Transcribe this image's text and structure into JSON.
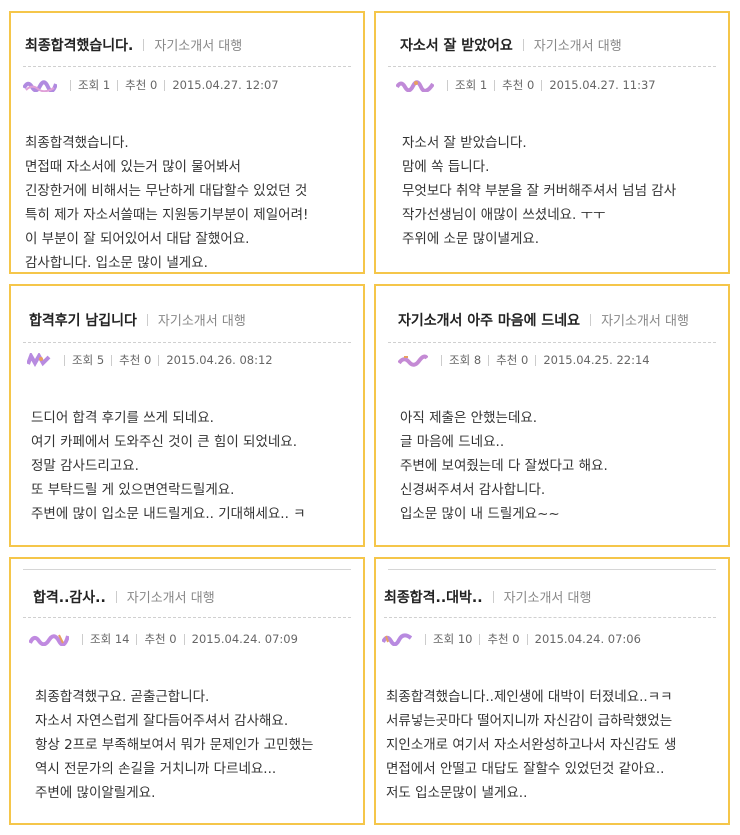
{
  "posts": [
    {
      "title": "최종합격했습니다.",
      "category": "자기소개서 대행",
      "views_label": "조회",
      "views": "1",
      "likes_label": "추천",
      "likes": "0",
      "date": "2015.04.27. 12:07",
      "avatar_color": "#b08ae0",
      "body": [
        "최종합격했습니다.",
        "면접때 자소서에 있는거 많이 물어봐서",
        "긴장한거에 비해서는 무난하게 대답할수 있었던 것",
        "특히 제가 자소서쓸때는 지원동기부분이 제일어려!",
        "이 부분이 잘 되어있어서 대답 잘했어요.",
        "감사합니다. 입소문 많이 낼게요."
      ]
    },
    {
      "title": "자소서 잘 받았어요",
      "category": "자기소개서 대행",
      "views_label": "조회",
      "views": "1",
      "likes_label": "추천",
      "likes": "0",
      "date": "2015.04.27. 11:37",
      "avatar_color": "#c08ad8",
      "body": [
        "자소서 잘 받았습니다.",
        "맘에 쏙 듭니다.",
        "무엇보다 취약 부분을 잘 커버해주셔서 넘넘 감사",
        "작가선생님이 애많이 쓰셨네요. ㅜㅜ",
        "주위에 소문 많이낼게요."
      ]
    },
    {
      "title": "합격후기 남깁니다",
      "category": "자기소개서 대행",
      "views_label": "조회",
      "views": "5",
      "likes_label": "추천",
      "likes": "0",
      "date": "2015.04.26. 08:12",
      "avatar_color": "#b88be0",
      "body": [
        "드디어 합격 후기를 쓰게 되네요.",
        "여기 카페에서 도와주신 것이 큰 힘이 되었네요.",
        "정말 감사드리고요.",
        "또 부탁드릴 게 있으면연락드릴게요.",
        "주변에 많이 입소문 내드릴게요.. 기대해세요.. ㅋ"
      ]
    },
    {
      "title": "자기소개서 아주 마음에 드네요",
      "category": "자기소개서 대행",
      "views_label": "조회",
      "views": "8",
      "likes_label": "추천",
      "likes": "0",
      "date": "2015.04.25. 22:14",
      "avatar_color": "#c48ad4",
      "body": [
        "아직 제출은 안했는데요.",
        "글 마음에 드네요..",
        "주변에 보여줬는데 다 잘썼다고 해요.",
        "신경써주셔서 감사합니다.",
        "입소문 많이 내 드릴게요~~"
      ]
    },
    {
      "title": "합격..감사..",
      "category": "자기소개서 대행",
      "views_label": "조회",
      "views": "14",
      "likes_label": "추천",
      "likes": "0",
      "date": "2015.04.24. 07:09",
      "avatar_color": "#c08ae0",
      "body": [
        "최종합격했구요. 곧출근합니다.",
        "자소서 자연스럽게 잘다듬어주셔서 감사해요.",
        "항상 2프로 부족해보여서 뭐가 문제인가 고민했는",
        "역시 전문가의 손길을 거치니까 다르네요...",
        "주변에 많이알릴게요."
      ]
    },
    {
      "title": "최종합격..대박..",
      "category": "자기소개서 대행",
      "views_label": "조회",
      "views": "10",
      "likes_label": "추천",
      "likes": "0",
      "date": "2015.04.24. 07:06",
      "avatar_color": "#b88ae0",
      "body": [
        "최종합격했습니다..제인생에 대박이 터졌네요..ㅋㅋ",
        "서류넣는곳마다 떨어지니까 자신감이 급하락했었는",
        "지인소개로 여기서 자소서완성하고나서 자신감도 생",
        "면접에서 안떨고 대답도 잘할수 있었던것 같아요..",
        "저도 입소문많이 낼게요.."
      ]
    }
  ]
}
